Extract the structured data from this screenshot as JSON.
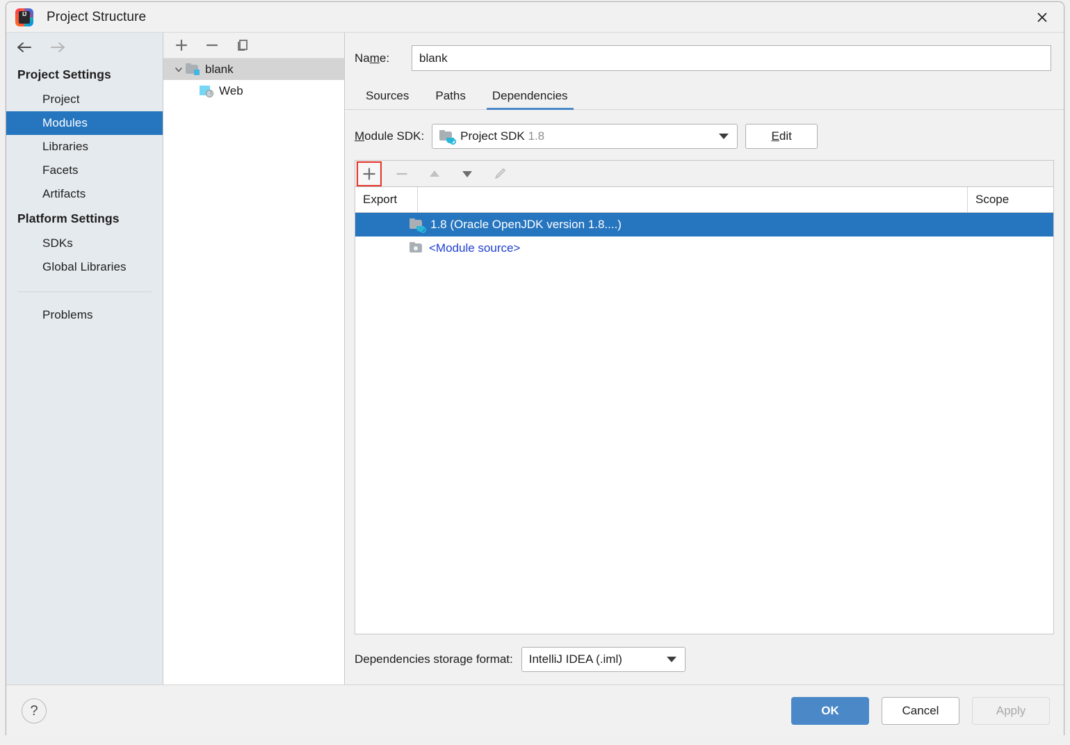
{
  "window": {
    "title": "Project Structure",
    "logo_text_top": "IJ",
    "close_icon": "close-icon"
  },
  "nav": {
    "back_icon": "arrow-left-icon",
    "forward_icon": "arrow-right-icon"
  },
  "sidebar": {
    "groups": [
      {
        "label": "Project Settings",
        "items": [
          {
            "label": "Project",
            "selected": false
          },
          {
            "label": "Modules",
            "selected": true
          },
          {
            "label": "Libraries",
            "selected": false
          },
          {
            "label": "Facets",
            "selected": false
          },
          {
            "label": "Artifacts",
            "selected": false
          }
        ]
      },
      {
        "label": "Platform Settings",
        "items": [
          {
            "label": "SDKs",
            "selected": false
          },
          {
            "label": "Global Libraries",
            "selected": false
          }
        ]
      }
    ],
    "extra_items": [
      {
        "label": "Problems",
        "selected": false
      }
    ]
  },
  "tree": {
    "toolbar": [
      {
        "name": "add-module-button",
        "icon": "plus-icon"
      },
      {
        "name": "remove-module-button",
        "icon": "minus-icon"
      },
      {
        "name": "copy-module-button",
        "icon": "copy-icon"
      }
    ],
    "nodes": [
      {
        "label": "blank",
        "icon": "module-folder-icon",
        "selected": true,
        "expanded": true,
        "level": 0
      },
      {
        "label": "Web",
        "icon": "web-facet-icon",
        "selected": false,
        "expanded": null,
        "level": 1
      }
    ]
  },
  "editor": {
    "name_label": "Name:",
    "name_label_mnemonic": "m",
    "name_value": "blank",
    "tabs": [
      {
        "label": "Sources",
        "active": false
      },
      {
        "label": "Paths",
        "active": false
      },
      {
        "label": "Dependencies",
        "active": true
      }
    ],
    "module_sdk": {
      "label": "Module SDK:",
      "label_mnemonic": "M",
      "value_main": "Project SDK",
      "value_version": "1.8",
      "edit_button": "Edit",
      "edit_button_mnemonic": "E"
    },
    "dep_toolbar": [
      {
        "name": "add-dependency-button",
        "icon": "plus-icon",
        "enabled": true,
        "highlighted": true
      },
      {
        "name": "remove-dependency-button",
        "icon": "minus-icon",
        "enabled": false,
        "highlighted": false
      },
      {
        "name": "move-up-button",
        "icon": "arrow-up-icon",
        "enabled": false,
        "highlighted": false
      },
      {
        "name": "move-down-button",
        "icon": "arrow-down-icon",
        "enabled": true,
        "highlighted": false
      },
      {
        "name": "edit-dependency-button",
        "icon": "pencil-icon",
        "enabled": false,
        "highlighted": false
      }
    ],
    "table": {
      "columns": [
        "Export",
        "",
        "Scope"
      ],
      "rows": [
        {
          "label": "1.8 (Oracle OpenJDK version 1.8....)",
          "icon": "sdk-folder-icon",
          "selected": true,
          "link": false,
          "export": "",
          "scope": ""
        },
        {
          "label": "<Module source>",
          "icon": "module-source-icon",
          "selected": false,
          "link": true,
          "export": "",
          "scope": ""
        }
      ]
    },
    "storage": {
      "label": "Dependencies storage format:",
      "value": "IntelliJ IDEA (.iml)"
    }
  },
  "footer": {
    "help_label": "?",
    "buttons": [
      {
        "label": "OK",
        "style": "primary"
      },
      {
        "label": "Cancel",
        "style": "normal"
      },
      {
        "label": "Apply",
        "style": "disabled"
      }
    ]
  },
  "colors": {
    "accent_blue": "#2675bf",
    "tab_underline": "#4a88c7",
    "link_blue": "#2040d0",
    "highlight_red": "#e8332a",
    "sidebar_bg": "#e5eaee",
    "panel_bg": "#f1f1f1"
  }
}
